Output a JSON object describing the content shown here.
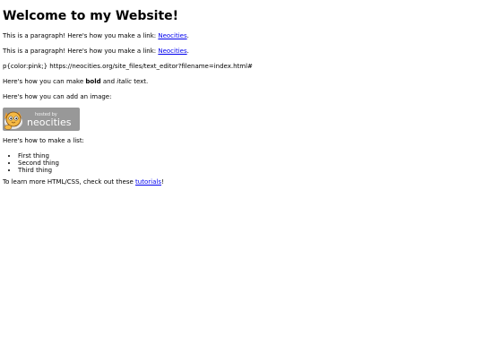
{
  "heading": "Welcome to my Website!",
  "para1": {
    "prefix": "This is a paragraph! Here's how you make a link: ",
    "link_text": "Neocities",
    "suffix": "."
  },
  "para2": {
    "prefix": "This is a paragraph! Here's how you make a link: ",
    "link_text": "Neocities",
    "suffix": "."
  },
  "raw_text": "p{color:pink;} https://neocities.org/site_files/text_editor?filename=index.html#",
  "format_line": {
    "prefix": "Here's how you can make ",
    "bold": "bold",
    "middle": " and ",
    "italic": "italic",
    "suffix": " text."
  },
  "image_line": "Here's how you can add an image:",
  "badge": {
    "small_text": "hosted by",
    "brand_text": "neocities",
    "bg_color": "#989898",
    "icon": "neocities-cat-icon"
  },
  "list_intro": "Here's how to make a list:",
  "list_items": [
    "First thing",
    "Second thing",
    "Third thing"
  ],
  "footer": {
    "prefix": "To learn more HTML/CSS, check out these ",
    "link_text": "tutorials",
    "suffix": "!"
  },
  "colors": {
    "link": "#0000ee",
    "text": "#000000",
    "background": "#ffffff"
  }
}
